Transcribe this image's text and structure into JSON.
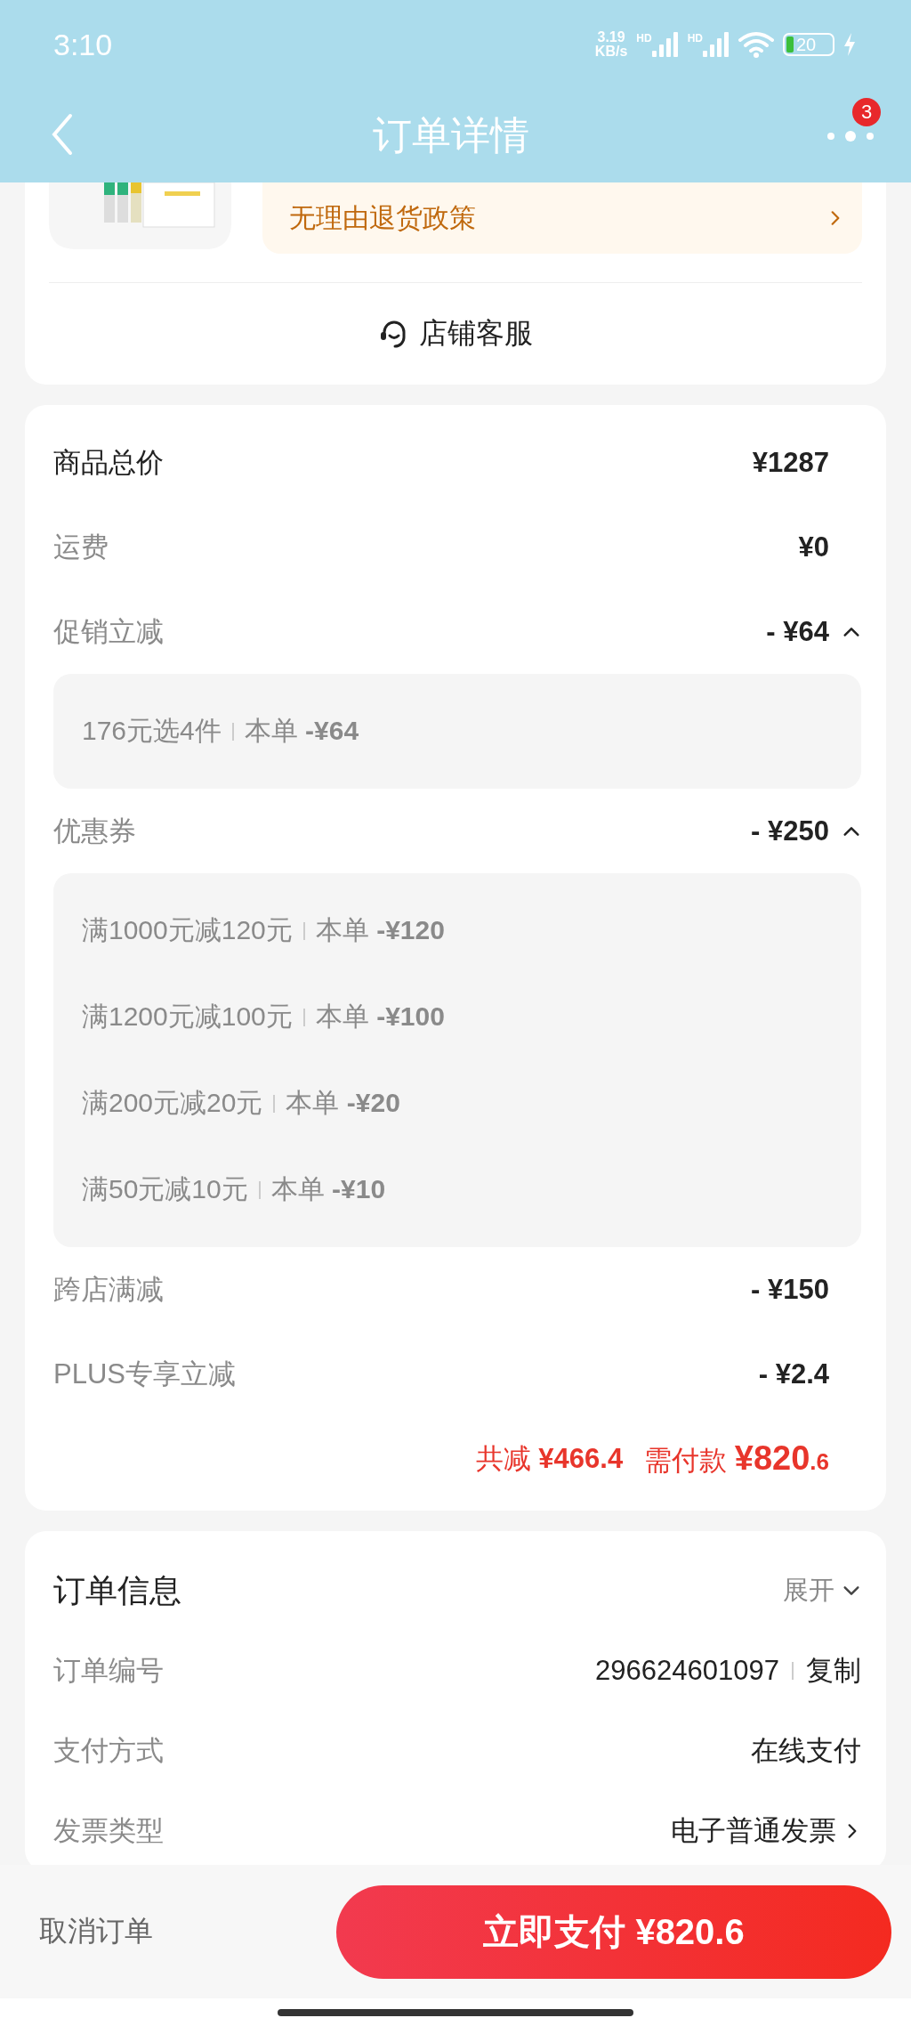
{
  "status_bar": {
    "time": "3:10",
    "speed_value": "3.19",
    "speed_unit": "KB/s",
    "network_labels": [
      "HD",
      "HD"
    ],
    "battery": "20"
  },
  "header": {
    "title": "订单详情",
    "badge": "3"
  },
  "store_card": {
    "policy": "无理由退货政策",
    "service": "店铺客服"
  },
  "price_card": {
    "rows": [
      {
        "label": "商品总价",
        "value": "¥1287",
        "emphasis": true
      },
      {
        "label": "运费",
        "value": "¥0",
        "emphasis": false
      },
      {
        "label": "促销立减",
        "value": "- ¥64",
        "emphasis": false,
        "expanded": true,
        "details": [
          {
            "rule": "176元选4件",
            "amount": "本单 **-¥64**"
          }
        ]
      },
      {
        "label": "优惠券",
        "value": "- ¥250",
        "emphasis": false,
        "expanded": true,
        "details": [
          {
            "rule": "满1000元减120元",
            "amount": "本单 **-¥120**"
          },
          {
            "rule": "满1200元减100元",
            "amount": "本单 **-¥100**"
          },
          {
            "rule": "满200元减20元",
            "amount": "本单 **-¥20**"
          },
          {
            "rule": "满50元减10元",
            "amount": "本单 **-¥10**"
          }
        ]
      },
      {
        "label": "跨店满减",
        "value": "- ¥150",
        "emphasis": false
      },
      {
        "label": "PLUS专享立减",
        "value": "- ¥2.4",
        "emphasis": false
      }
    ],
    "summary": {
      "reduced_label": "共减",
      "reduced_value": "¥466.4",
      "due_label": "需付款",
      "due_integer": "¥820",
      "due_fraction": ".6"
    }
  },
  "order_card": {
    "title": "订单信息",
    "toggle": "展开",
    "expanded": false,
    "rows": [
      {
        "label": "订单编号",
        "value": "296624601097",
        "action": "复制"
      },
      {
        "label": "支付方式",
        "value": "在线支付"
      },
      {
        "label": "发票类型",
        "value": "电子普通发票",
        "link": true
      }
    ]
  },
  "bottom_bar": {
    "cancel": "取消订单",
    "pay": "立即支付 ¥820.6"
  }
}
